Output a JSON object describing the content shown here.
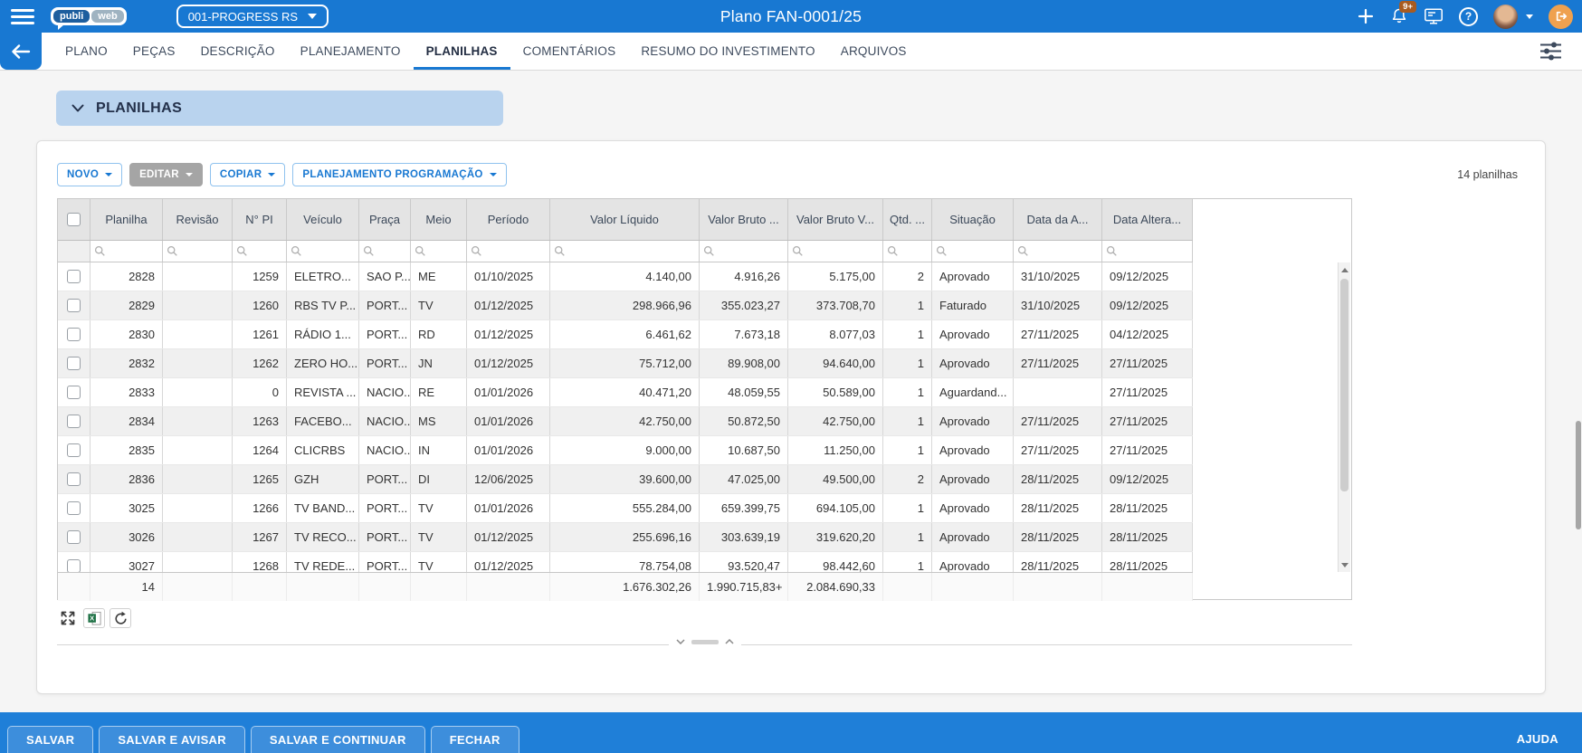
{
  "topbar": {
    "logo_primary": "publi",
    "logo_secondary": "web",
    "company_select": "001-PROGRESS RS",
    "title": "Plano FAN-0001/25",
    "notification_count": "9+",
    "help_glyph": "?"
  },
  "navbar": {
    "tabs": [
      "PLANO",
      "PEÇAS",
      "DESCRIÇÃO",
      "PLANEJAMENTO",
      "PLANILHAS",
      "COMENTÁRIOS",
      "RESUMO DO INVESTIMENTO",
      "ARQUIVOS"
    ],
    "active_tab": "PLANILHAS"
  },
  "section": {
    "title": "PLANILHAS"
  },
  "toolbar": {
    "buttons": [
      {
        "label": "NOVO",
        "disabled": false
      },
      {
        "label": "EDITAR",
        "disabled": true
      },
      {
        "label": "COPIAR",
        "disabled": false
      },
      {
        "label": "PLANEJAMENTO PROGRAMAÇÃO",
        "disabled": false
      }
    ],
    "count_label": "14 planilhas"
  },
  "grid": {
    "columns": [
      "Planilha",
      "Revisão",
      "N° PI",
      "Veículo",
      "Praça",
      "Meio",
      "Período",
      "Valor Líquido",
      "Valor Bruto ...",
      "Valor Bruto V...",
      "Qtd. ...",
      "Situação",
      "Data da A...",
      "Data Altera..."
    ],
    "rows": [
      {
        "planilha": "2828",
        "revisao": "",
        "pi": "1259",
        "veiculo": "ELETRO...",
        "praca": "SAO P...",
        "meio": "ME",
        "periodo": "01/10/2025",
        "valor_liquido": "4.140,00",
        "valor_bruto": "4.916,26",
        "valor_bruto_v": "5.175,00",
        "qtd": "2",
        "situacao": "Aprovado",
        "data_aprovacao": "31/10/2025",
        "data_alteracao": "09/12/2025"
      },
      {
        "planilha": "2829",
        "revisao": "",
        "pi": "1260",
        "veiculo": "RBS TV P...",
        "praca": "PORT...",
        "meio": "TV",
        "periodo": "01/12/2025",
        "valor_liquido": "298.966,96",
        "valor_bruto": "355.023,27",
        "valor_bruto_v": "373.708,70",
        "qtd": "1",
        "situacao": "Faturado",
        "data_aprovacao": "31/10/2025",
        "data_alteracao": "09/12/2025"
      },
      {
        "planilha": "2830",
        "revisao": "",
        "pi": "1261",
        "veiculo": "RÁDIO 1...",
        "praca": "PORT...",
        "meio": "RD",
        "periodo": "01/12/2025",
        "valor_liquido": "6.461,62",
        "valor_bruto": "7.673,18",
        "valor_bruto_v": "8.077,03",
        "qtd": "1",
        "situacao": "Aprovado",
        "data_aprovacao": "27/11/2025",
        "data_alteracao": "04/12/2025"
      },
      {
        "planilha": "2832",
        "revisao": "",
        "pi": "1262",
        "veiculo": "ZERO HO...",
        "praca": "PORT...",
        "meio": "JN",
        "periodo": "01/12/2025",
        "valor_liquido": "75.712,00",
        "valor_bruto": "89.908,00",
        "valor_bruto_v": "94.640,00",
        "qtd": "1",
        "situacao": "Aprovado",
        "data_aprovacao": "27/11/2025",
        "data_alteracao": "27/11/2025"
      },
      {
        "planilha": "2833",
        "revisao": "",
        "pi": "0",
        "veiculo": "REVISTA ...",
        "praca": "NACIO...",
        "meio": "RE",
        "periodo": "01/01/2026",
        "valor_liquido": "40.471,20",
        "valor_bruto": "48.059,55",
        "valor_bruto_v": "50.589,00",
        "qtd": "1",
        "situacao": "Aguardand...",
        "data_aprovacao": "",
        "data_alteracao": "27/11/2025"
      },
      {
        "planilha": "2834",
        "revisao": "",
        "pi": "1263",
        "veiculo": "FACEBO...",
        "praca": "NACIO...",
        "meio": "MS",
        "periodo": "01/01/2026",
        "valor_liquido": "42.750,00",
        "valor_bruto": "50.872,50",
        "valor_bruto_v": "42.750,00",
        "qtd": "1",
        "situacao": "Aprovado",
        "data_aprovacao": "27/11/2025",
        "data_alteracao": "27/11/2025"
      },
      {
        "planilha": "2835",
        "revisao": "",
        "pi": "1264",
        "veiculo": "CLICRBS",
        "praca": "NACIO...",
        "meio": "IN",
        "periodo": "01/01/2026",
        "valor_liquido": "9.000,00",
        "valor_bruto": "10.687,50",
        "valor_bruto_v": "11.250,00",
        "qtd": "1",
        "situacao": "Aprovado",
        "data_aprovacao": "27/11/2025",
        "data_alteracao": "27/11/2025"
      },
      {
        "planilha": "2836",
        "revisao": "",
        "pi": "1265",
        "veiculo": "GZH",
        "praca": "PORT...",
        "meio": "DI",
        "periodo": "12/06/2025",
        "valor_liquido": "39.600,00",
        "valor_bruto": "47.025,00",
        "valor_bruto_v": "49.500,00",
        "qtd": "2",
        "situacao": "Aprovado",
        "data_aprovacao": "28/11/2025",
        "data_alteracao": "09/12/2025"
      },
      {
        "planilha": "3025",
        "revisao": "",
        "pi": "1266",
        "veiculo": "TV BAND...",
        "praca": "PORT...",
        "meio": "TV",
        "periodo": "01/01/2026",
        "valor_liquido": "555.284,00",
        "valor_bruto": "659.399,75",
        "valor_bruto_v": "694.105,00",
        "qtd": "1",
        "situacao": "Aprovado",
        "data_aprovacao": "28/11/2025",
        "data_alteracao": "28/11/2025"
      },
      {
        "planilha": "3026",
        "revisao": "",
        "pi": "1267",
        "veiculo": "TV RECO...",
        "praca": "PORT...",
        "meio": "TV",
        "periodo": "01/12/2025",
        "valor_liquido": "255.696,16",
        "valor_bruto": "303.639,19",
        "valor_bruto_v": "319.620,20",
        "qtd": "1",
        "situacao": "Aprovado",
        "data_aprovacao": "28/11/2025",
        "data_alteracao": "28/11/2025"
      },
      {
        "planilha": "3027",
        "revisao": "",
        "pi": "1268",
        "veiculo": "TV REDE...",
        "praca": "PORT...",
        "meio": "TV",
        "periodo": "01/12/2025",
        "valor_liquido": "78.754,08",
        "valor_bruto": "93.520,47",
        "valor_bruto_v": "98.442,60",
        "qtd": "1",
        "situacao": "Aprovado",
        "data_aprovacao": "28/11/2025",
        "data_alteracao": "28/11/2025"
      }
    ],
    "footer": {
      "count": "14",
      "valor_liquido": "1.676.302,26",
      "valor_bruto": "1.990.715,83+",
      "valor_bruto_v": "2.084.690,33"
    }
  },
  "footerbar": {
    "buttons": [
      "SALVAR",
      "SALVAR E AVISAR",
      "SALVAR E CONTINUAR",
      "FECHAR"
    ],
    "help_label": "AJUDA"
  },
  "icons": {
    "topbar": [
      "menu-icon",
      "plus-icon",
      "notifications-bell-icon",
      "display-icon",
      "help-icon",
      "user-avatar",
      "caret-down-icon",
      "logout-icon"
    ],
    "navbar": [
      "back-arrow-icon",
      "filter-sliders-icon"
    ],
    "grid": [
      "search-icon",
      "expand-icon",
      "excel-export-icon",
      "refresh-icon",
      "chevron-down-icon",
      "chevron-up-icon"
    ]
  },
  "colors": {
    "topbar_blue": "#1878d2",
    "bottombar_blue": "#1f7fd8",
    "section_chip_blue": "#b9d3ee",
    "accent_blue": "#1878d2",
    "disabled_gray": "#a5a5a5",
    "badge_orange": "#a85b20",
    "logout_orange": "#efa14f",
    "header_gray": "#e4e4e4",
    "row_stripe": "#f0f0f0"
  }
}
